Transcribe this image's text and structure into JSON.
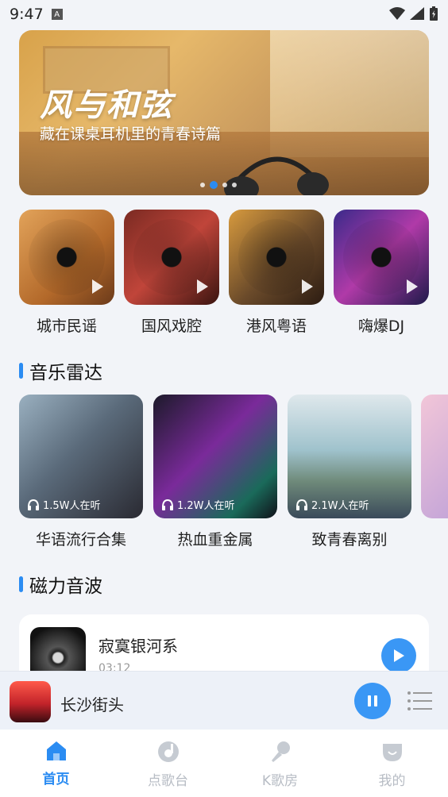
{
  "status": {
    "time": "9:47",
    "app_badge": "A"
  },
  "banner": {
    "title": "风与和弦",
    "subtitle": "藏在课桌耳机里的青春诗篇"
  },
  "categories": [
    {
      "label": "城市民谣"
    },
    {
      "label": "国风戏腔"
    },
    {
      "label": "港风粤语"
    },
    {
      "label": "嗨爆DJ"
    }
  ],
  "radar": {
    "title": "音乐雷达",
    "items": [
      {
        "label": "华语流行合集",
        "listeners": "1.5W人在听"
      },
      {
        "label": "热血重金属",
        "listeners": "1.2W人在听"
      },
      {
        "label": "致青春离别",
        "listeners": "2.1W人在听"
      }
    ]
  },
  "magnetic": {
    "title": "磁力音波",
    "track": {
      "title": "寂寞银河系",
      "duration": "03:12"
    }
  },
  "player": {
    "title": "长沙街头"
  },
  "nav": {
    "home": "首页",
    "song_station": "点歌台",
    "k_room": "K歌房",
    "mine": "我的"
  },
  "colors": {
    "accent": "#2b8cf2",
    "nav_inactive": "#b7bcc4"
  }
}
